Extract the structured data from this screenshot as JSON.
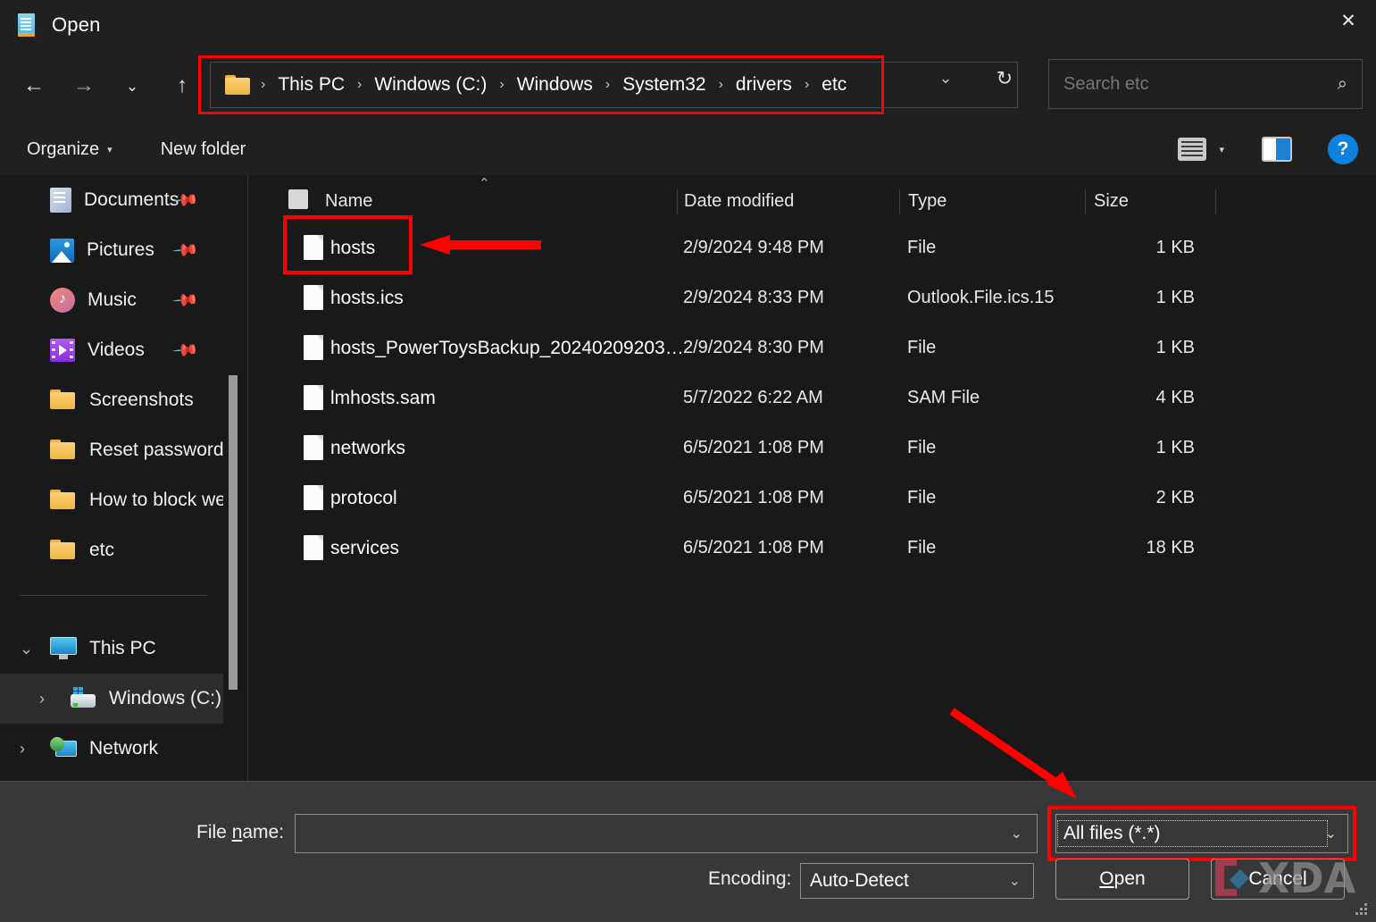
{
  "window": {
    "title": "Open",
    "icon": "notepad-icon",
    "close_label": "✕"
  },
  "nav": {
    "back": "←",
    "forward": "→",
    "recent": "⌄",
    "up": "↑",
    "dropdown": "⌄",
    "refresh": "↻"
  },
  "breadcrumb": {
    "folder_icon": "folder-icon",
    "separator": "›",
    "items": [
      "This PC",
      "Windows (C:)",
      "Windows",
      "System32",
      "drivers",
      "etc"
    ]
  },
  "search": {
    "placeholder": "Search etc",
    "value": "",
    "icon": "search-icon"
  },
  "toolbar": {
    "organize": "Organize",
    "organize_caret": "▾",
    "new_folder": "New folder",
    "view_caret": "▾",
    "help": "?"
  },
  "sidebar": {
    "items": [
      {
        "label": "Documents",
        "icon": "documents-icon",
        "pinned": true,
        "twisty": "",
        "selected": false,
        "indent": 1
      },
      {
        "label": "Pictures",
        "icon": "pictures-icon",
        "pinned": true,
        "twisty": "",
        "selected": false,
        "indent": 1
      },
      {
        "label": "Music",
        "icon": "music-icon",
        "pinned": true,
        "twisty": "",
        "selected": false,
        "indent": 1
      },
      {
        "label": "Videos",
        "icon": "videos-icon",
        "pinned": true,
        "twisty": "",
        "selected": false,
        "indent": 1
      },
      {
        "label": "Screenshots",
        "icon": "folder-icon",
        "pinned": false,
        "twisty": "",
        "selected": false,
        "indent": 1
      },
      {
        "label": "Reset password",
        "icon": "folder-icon",
        "pinned": false,
        "twisty": "",
        "selected": false,
        "indent": 1
      },
      {
        "label": "How to block we",
        "icon": "folder-icon",
        "pinned": false,
        "twisty": "",
        "selected": false,
        "indent": 1
      },
      {
        "label": "etc",
        "icon": "folder-icon",
        "pinned": false,
        "twisty": "",
        "selected": false,
        "indent": 1
      }
    ],
    "tree": [
      {
        "label": "This PC",
        "icon": "this-pc-icon",
        "twisty": "⌄",
        "selected": false
      },
      {
        "label": "Windows (C:)",
        "icon": "drive-icon",
        "twisty": "›",
        "selected": true
      },
      {
        "label": "Network",
        "icon": "network-icon",
        "twisty": "›",
        "selected": false
      }
    ],
    "pin_glyph": "📌"
  },
  "filelist": {
    "collapse_caret": "⌃",
    "columns": [
      "Name",
      "Date modified",
      "Type",
      "Size"
    ],
    "rows": [
      {
        "name": "hosts",
        "date": "2/9/2024 9:48 PM",
        "type": "File",
        "size": "1 KB"
      },
      {
        "name": "hosts.ics",
        "date": "2/9/2024 8:33 PM",
        "type": "Outlook.File.ics.15",
        "size": "1 KB"
      },
      {
        "name": "hosts_PowerToysBackup_20240209203…",
        "date": "2/9/2024 8:30 PM",
        "type": "File",
        "size": "1 KB"
      },
      {
        "name": "lmhosts.sam",
        "date": "5/7/2022 6:22 AM",
        "type": "SAM File",
        "size": "4 KB"
      },
      {
        "name": "networks",
        "date": "6/5/2021 1:08 PM",
        "type": "File",
        "size": "1 KB"
      },
      {
        "name": "protocol",
        "date": "6/5/2021 1:08 PM",
        "type": "File",
        "size": "2 KB"
      },
      {
        "name": "services",
        "date": "6/5/2021 1:08 PM",
        "type": "File",
        "size": "18 KB"
      }
    ]
  },
  "footer": {
    "filename_label": "File name:",
    "filename_value": "",
    "filename_caret": "⌄",
    "encoding_label": "Encoding:",
    "encoding_value": "Auto-Detect",
    "encoding_caret": "⌄",
    "filetype_value": "All files  (*.*)",
    "filetype_caret": "⌄",
    "open_button": "Open",
    "cancel_button": "Cancel"
  },
  "annotations": {
    "accent_red": "#ff0000",
    "highlight_address_bar": true,
    "highlight_hosts_file": true,
    "highlight_filetype_dropdown": true,
    "watermark": "XDA"
  }
}
